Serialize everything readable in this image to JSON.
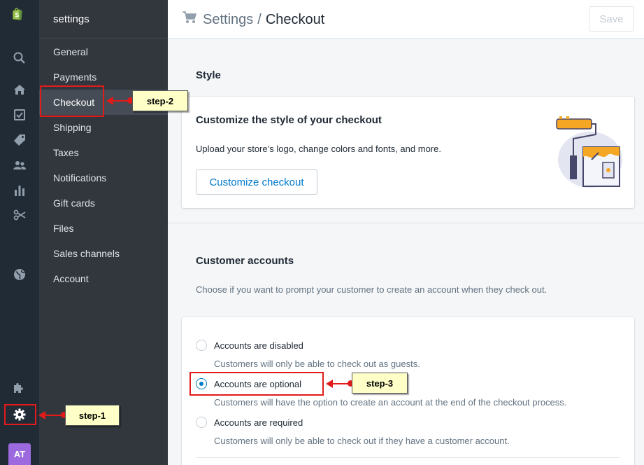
{
  "header": {
    "breadcrumb_parent": "Settings",
    "breadcrumb_separator": "/",
    "breadcrumb_current": "Checkout",
    "save_label": "Save"
  },
  "settings_nav": {
    "title": "settings",
    "items": [
      {
        "label": "General"
      },
      {
        "label": "Payments"
      },
      {
        "label": "Checkout",
        "active": true
      },
      {
        "label": "Shipping"
      },
      {
        "label": "Taxes"
      },
      {
        "label": "Notifications"
      },
      {
        "label": "Gift cards"
      },
      {
        "label": "Files"
      },
      {
        "label": "Sales channels"
      },
      {
        "label": "Account"
      }
    ]
  },
  "rail": {
    "icons": [
      "shopify-logo-icon",
      "search-icon",
      "home-icon",
      "orders-icon",
      "products-icon",
      "customers-icon",
      "analytics-icon",
      "discounts-icon",
      "online-store-icon",
      "apps-icon",
      "settings-icon"
    ],
    "avatar_initials": "AT"
  },
  "style_section": {
    "heading": "Style",
    "card_title": "Customize the style of your checkout",
    "card_text": "Upload your store’s logo, change colors and fonts, and more.",
    "button_label": "Customize checkout"
  },
  "accounts_section": {
    "heading": "Customer accounts",
    "description": "Choose if you want to prompt your customer to create an account when they check out.",
    "options": [
      {
        "label": "Accounts are disabled",
        "help": "Customers will only be able to check out as guests.",
        "checked": false
      },
      {
        "label": "Accounts are optional",
        "help": "Customers will have the option to create an account at the end of the checkout process.",
        "checked": true
      },
      {
        "label": "Accounts are required",
        "help": "Customers will only be able to check out if they have a customer account.",
        "checked": false
      }
    ]
  },
  "annotations": {
    "step1": "step-1",
    "step2": "step-2",
    "step3": "step-3"
  },
  "colors": {
    "rail_bg": "#212b36",
    "nav_bg": "#31373d",
    "accent": "#007ace",
    "annotation_red": "#e21a1a",
    "callout_bg": "#ffffc8",
    "avatar": "#9c6ade"
  }
}
